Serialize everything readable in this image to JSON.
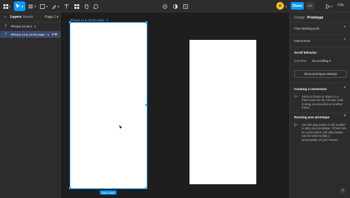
{
  "toolbar": {
    "share_label": "Share",
    "avatar_initial": "A",
    "code_label": "</>",
    "zoom": "71%",
    "play_caret": "▾"
  },
  "left_panel": {
    "tabs": [
      "Layers",
      "Assets"
    ],
    "page_selector": "Page 1 ▾",
    "layers": [
      {
        "name": "iPhone 13 mini - 1",
        "selected": false
      },
      {
        "name": "iPhone 14 & 15 Pro Max - 1",
        "selected": true
      }
    ]
  },
  "canvas": {
    "frame_label": "iPhone 14 & 15 Pro Max - 1",
    "size_badge": "430 × 932"
  },
  "right_panel": {
    "tabs": [
      "Design",
      "Prototype"
    ],
    "flow_starting_point": "Flow starting point",
    "interactions": "Interactions",
    "scroll_behavior": "Scroll behavior",
    "overflow_label": "Overflow",
    "overflow_value": "No scrolling ▾",
    "show_prototype_settings": "Show prototype settings",
    "creating_connection": {
      "title": "Creating a connection",
      "body": "Select a frame or object in a frame and use the circular node to drag a connection to another frame."
    },
    "running_prototype": {
      "title": "Running your prototype",
      "body": "Use the play button in the toolbar to play your prototype. If there are no connections, the play button can be used to play a presentation of your frames."
    },
    "help": "?"
  },
  "colors": {
    "accent": "#0d99ff",
    "panel_bg": "#2c2c2c",
    "canvas_bg": "#1e1e1e"
  }
}
